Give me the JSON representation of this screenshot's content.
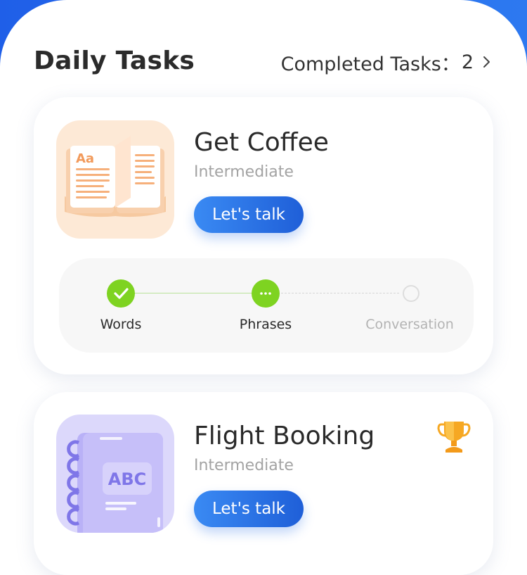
{
  "header": {
    "title": "Daily Tasks",
    "completed_label": "Completed Tasks：",
    "completed_count": "2"
  },
  "colors": {
    "primary_blue": "#2d79f0",
    "success_green": "#7ed321",
    "title_text": "#2b2b2b",
    "muted_text": "#a3a3a3"
  },
  "tasks": [
    {
      "title": "Get Coffee",
      "level": "Intermediate",
      "button_label": "Let's talk",
      "thumbnail_icon": "open-book-icon",
      "thumbnail_text": "Aa",
      "steps": [
        {
          "label": "Words",
          "status": "done"
        },
        {
          "label": "Phrases",
          "status": "in-progress"
        },
        {
          "label": "Conversation",
          "status": "pending"
        }
      ]
    },
    {
      "title": "Flight Booking",
      "level": "Intermediate",
      "button_label": "Let's talk",
      "thumbnail_icon": "notebook-icon",
      "thumbnail_text": "ABC",
      "badge_icon": "trophy-icon"
    }
  ]
}
